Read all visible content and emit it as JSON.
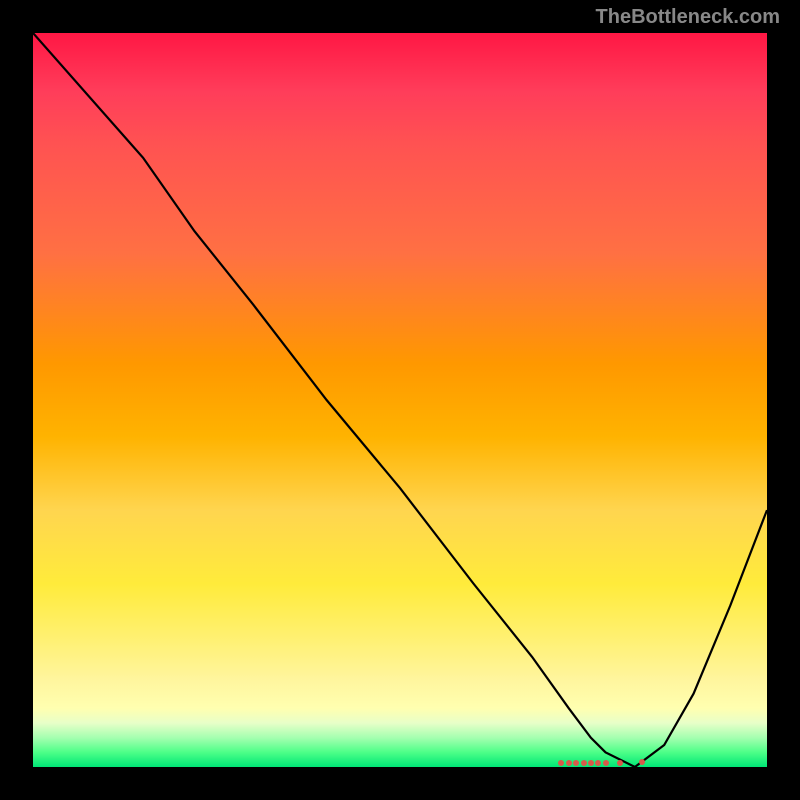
{
  "watermark": "TheBottleneck.com",
  "chart_data": {
    "type": "line",
    "title": "",
    "xlabel": "",
    "ylabel": "",
    "xlim": [
      0,
      100
    ],
    "ylim": [
      0,
      100
    ],
    "curve": {
      "x": [
        0,
        15,
        22,
        30,
        40,
        50,
        60,
        68,
        73,
        76,
        78,
        82,
        86,
        90,
        95,
        100
      ],
      "y": [
        100,
        83,
        73,
        63,
        50,
        38,
        25,
        15,
        8,
        4,
        2,
        0,
        3,
        10,
        22,
        35
      ]
    },
    "markers": {
      "x": [
        72,
        73,
        74,
        75,
        76,
        77,
        78,
        80,
        83
      ],
      "y": [
        0.5,
        0.5,
        0.5,
        0.5,
        0.5,
        0.5,
        0.5,
        0.5,
        0.7
      ]
    },
    "background": {
      "type": "gradient",
      "direction": "vertical",
      "stops": [
        {
          "pos": 0,
          "color": "#ff1744"
        },
        {
          "pos": 50,
          "color": "#ffb300"
        },
        {
          "pos": 85,
          "color": "#fff176"
        },
        {
          "pos": 100,
          "color": "#00e676"
        }
      ]
    }
  }
}
